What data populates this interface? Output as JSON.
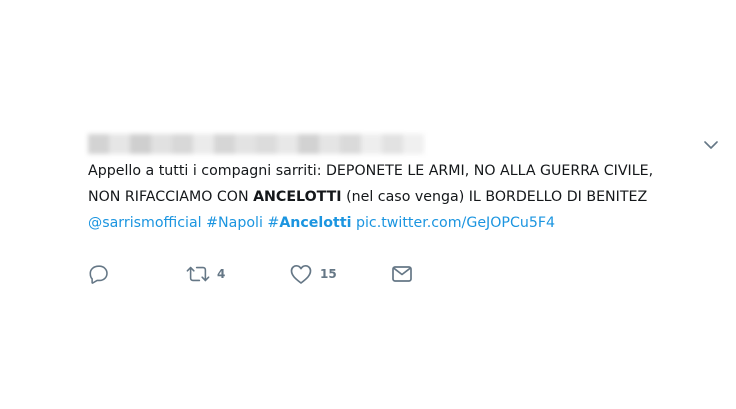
{
  "tweet": {
    "line1": "Appello a tutti i compagni sarriti: DEPONETE LE ARMI, NO ALLA GUERRA CIVILE,",
    "line2_pre": "NON RIFACCIAMO CON ",
    "line2_bold": "ANCELOTTI",
    "line2_post": " (nel caso venga) IL BORDELLO DI BENITEZ",
    "mention": "@sarrismofficial",
    "hashtag1": "#Napoli",
    "hashtag2_hash": "#",
    "hashtag2_word": "Ancelotti",
    "pic_link": "pic.twitter.com/GeJOPCu5F4"
  },
  "actions": {
    "reply_icon": "reply-icon",
    "retweet_icon": "retweet-icon",
    "retweet_count": "4",
    "like_icon": "heart-icon",
    "like_count": "15",
    "dm_icon": "envelope-icon"
  },
  "colors": {
    "link": "#1b95e0",
    "icon": "#657786",
    "text": "#14171a"
  }
}
